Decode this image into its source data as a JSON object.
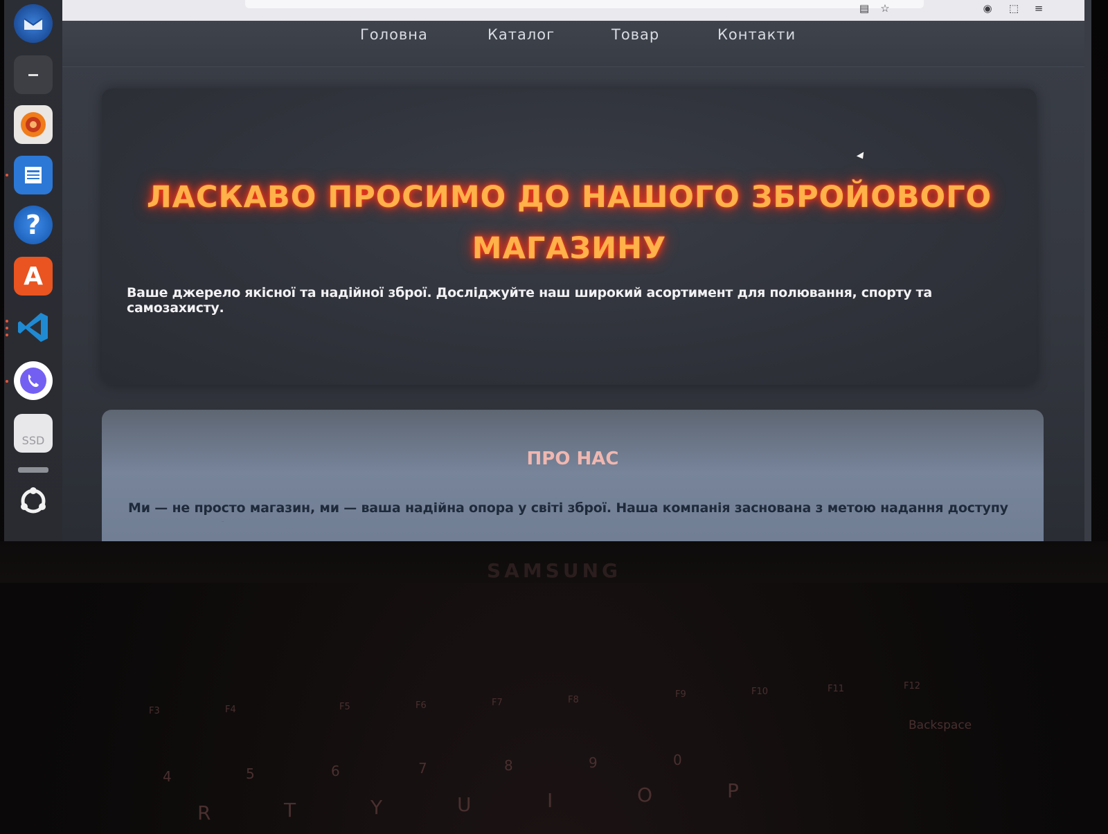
{
  "nav": {
    "items": [
      "Головна",
      "Каталог",
      "Товар",
      "Контакти"
    ]
  },
  "hero": {
    "title_line1": "ЛАСКАВО ПРОСИМО ДО НАШОГО ЗБРОЙОВОГО",
    "title_line2": "МАГАЗИНУ",
    "subtitle": "Ваше джерело якісної та надійної зброї. Досліджуйте наш широкий асортимент для полювання, спорту та самозахисту."
  },
  "about": {
    "heading": "ПРО НАС",
    "text": "Ми — не просто магазин, ми — ваша надійна опора у світі зброї. Наша компанія заснована з метою надання доступу до високоякісного та"
  },
  "laptop": {
    "brand": "SAMSUNG",
    "fn_keys": [
      "F3",
      "F4",
      "F5",
      "F6",
      "F7",
      "F8",
      "F9",
      "F10",
      "F11",
      "F12"
    ],
    "number_keys": [
      "4",
      "5",
      "6",
      "7",
      "8",
      "9",
      "0"
    ],
    "letter_keys": [
      "R",
      "T",
      "Y",
      "U",
      "I",
      "O",
      "P"
    ],
    "backspace": "Backspace"
  },
  "dock": {
    "icons": [
      "thunderbird-icon",
      "files-icon",
      "rhythmbox-icon",
      "writer-icon",
      "help-icon",
      "app-center-icon",
      "vscode-icon",
      "viber-icon",
      "ssd-drive-icon",
      "ubuntu-apps-icon"
    ]
  },
  "colors": {
    "title_glow": "#ff3b1a",
    "title_fill": "#ffb14a",
    "about_heading": "#f0b7b0"
  }
}
